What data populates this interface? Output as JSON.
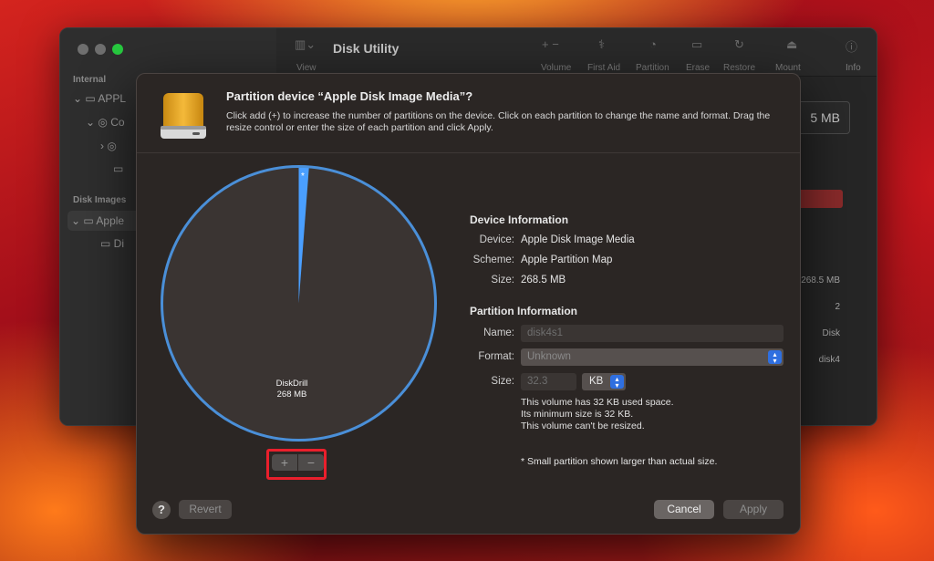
{
  "background_window": {
    "title": "Disk Utility",
    "sidebar": {
      "section_internal": "Internal",
      "item_1": "APPL",
      "item_2": "Co",
      "section_disk_images": "Disk Images",
      "item_3": "Apple",
      "item_4": "Di"
    },
    "toolbar": {
      "view": "View",
      "volume": "Volume",
      "first_aid": "First Aid",
      "partition": "Partition",
      "erase": "Erase",
      "restore": "Restore",
      "mount": "Mount",
      "info": "Info"
    },
    "size_box": "5 MB",
    "table": [
      "268.5 MB",
      "2",
      "Disk",
      "disk4"
    ]
  },
  "dialog": {
    "title": "Partition device “Apple Disk Image Media”?",
    "description": "Click add (+) to increase the number of partitions on the device. Click on each partition to change the name and format. Drag the resize control or enter the size of each partition and click Apply.",
    "pie": {
      "partition_name": "DiskDrill",
      "partition_size": "268 MB",
      "small_marker": "*",
      "small_slice_fraction": 0.012,
      "colors": {
        "main": "#3a3432",
        "small": "#4a9fff",
        "ring": "#4a8fd8"
      }
    },
    "plus_label": "+",
    "minus_label": "−",
    "device_info": {
      "heading": "Device Information",
      "device_label": "Device:",
      "device_value": "Apple Disk Image Media",
      "scheme_label": "Scheme:",
      "scheme_value": "Apple Partition Map",
      "size_label": "Size:",
      "size_value": "268.5 MB"
    },
    "partition_info": {
      "heading": "Partition Information",
      "name_label": "Name:",
      "name_value": "disk4s1",
      "format_label": "Format:",
      "format_value": "Unknown",
      "size_label": "Size:",
      "size_value": "32.3",
      "size_unit": "KB",
      "note_1": "This volume has 32 KB used space.",
      "note_2": "Its minimum size is 32 KB.",
      "note_3": "This volume can't be resized."
    },
    "footnote": "* Small partition shown larger than actual size.",
    "help_label": "?",
    "revert_label": "Revert",
    "cancel_label": "Cancel",
    "apply_label": "Apply",
    "highlight_color": "#ea1f2c"
  }
}
